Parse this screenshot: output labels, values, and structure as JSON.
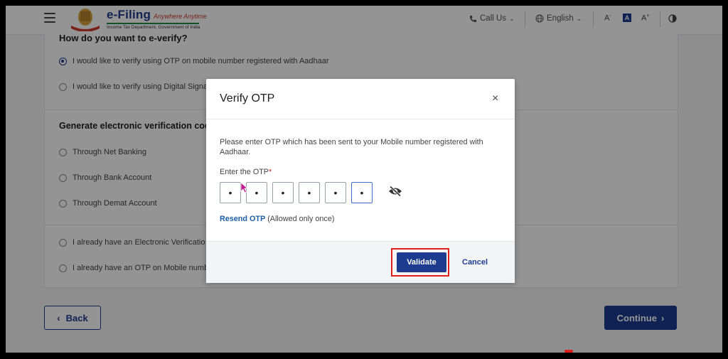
{
  "header": {
    "brand_name": "e-Filing",
    "brand_tagline": "Anywhere Anytime",
    "brand_sub": "Income Tax Department, Government of India",
    "call_us": "Call Us",
    "language": "English",
    "font_decrease": "A",
    "font_normal": "A",
    "font_increase": "A"
  },
  "page": {
    "question": "How do you want to e-verify?",
    "options_top": [
      {
        "label": "I would like to verify using OTP on mobile number registered with Aadhaar",
        "checked": true
      },
      {
        "label": "I would like to verify using Digital Signa",
        "checked": false
      }
    ],
    "section_title": "Generate electronic verification code",
    "options_evc": [
      {
        "label": "Through Net Banking"
      },
      {
        "label": "Through Bank Account"
      },
      {
        "label": "Through Demat Account"
      }
    ],
    "options_bottom": [
      {
        "label": "I already have an Electronic Verificatio"
      },
      {
        "label": "I already have an OTP on Mobile numbe"
      }
    ],
    "back_label": "Back",
    "continue_label": "Continue"
  },
  "modal": {
    "title": "Verify OTP",
    "close": "×",
    "message": "Please enter OTP which has been sent to your Mobile number registered with Aadhaar.",
    "otp_label": "Enter the OTP",
    "required_mark": "*",
    "otp_digits": [
      "•",
      "•",
      "•",
      "•",
      "•",
      "•"
    ],
    "resend_link": "Resend OTP",
    "resend_note": "(Allowed only once)",
    "validate_label": "Validate",
    "cancel_label": "Cancel"
  },
  "colors": {
    "primary": "#1d3c8f",
    "highlight": "#e01e1e",
    "link": "#1d5fa8"
  }
}
